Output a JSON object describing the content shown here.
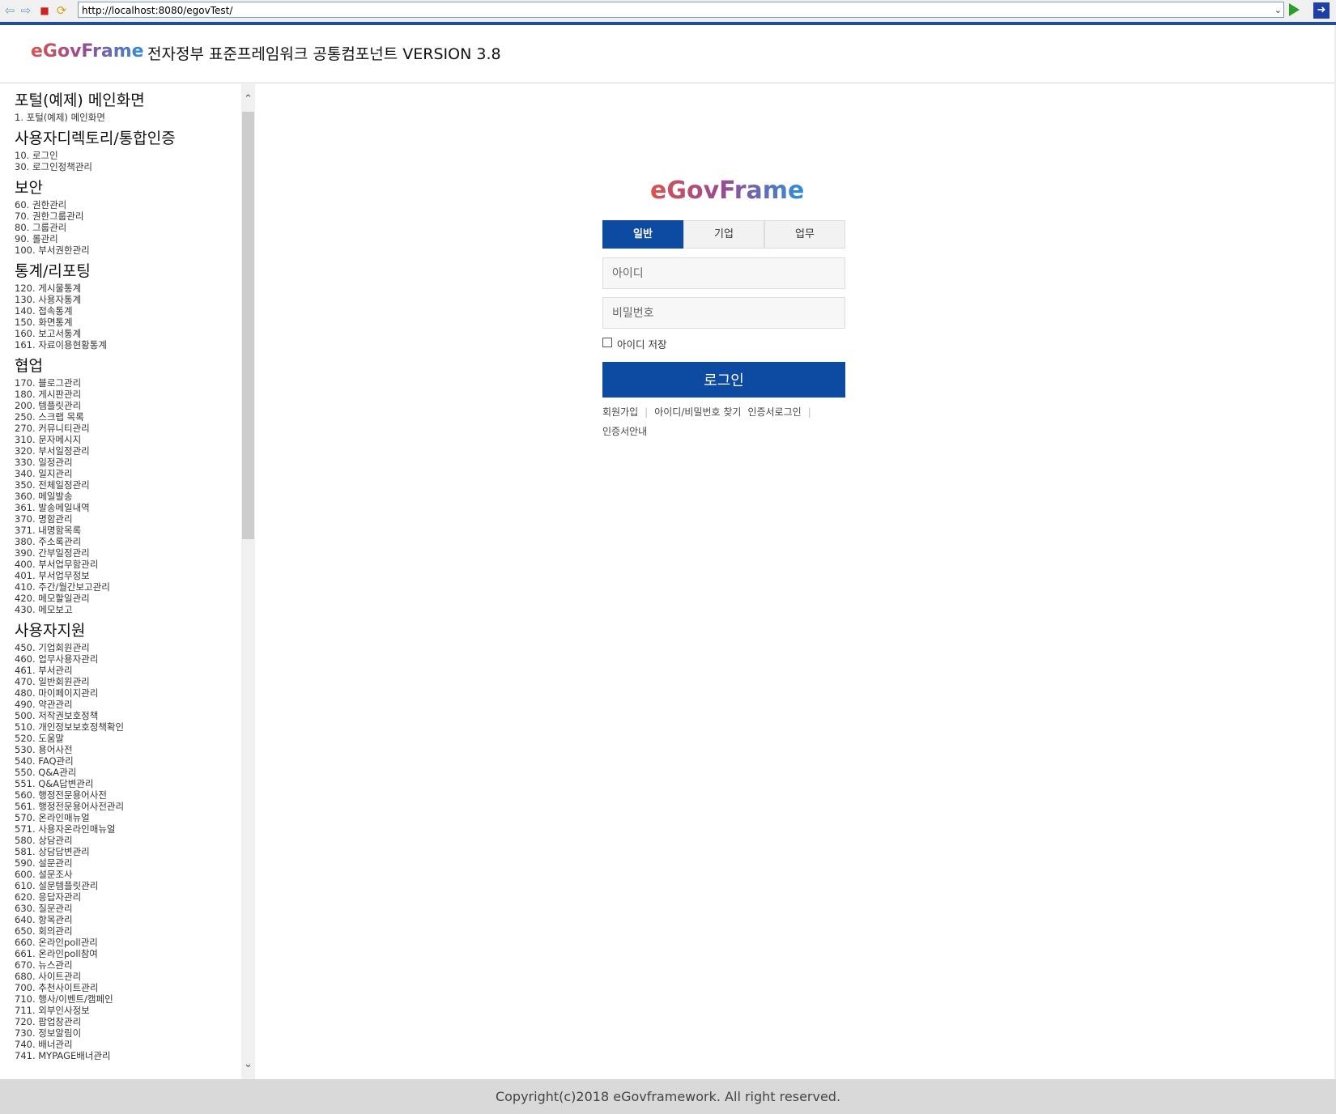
{
  "browser": {
    "url": "http://localhost:8080/egovTest/",
    "icons": [
      "back-icon",
      "forward-icon",
      "stop-icon",
      "refresh-icon",
      "dropdown-icon",
      "go-icon",
      "extension-icon"
    ]
  },
  "header": {
    "logo": "eGovFrame",
    "title": "전자정부 표준프레임워크 공통컴포넌트 VERSION 3.8"
  },
  "sidebar": {
    "groups": [
      {
        "title": "포털(예제) 메인화면",
        "items": [
          "1. 포털(예제) 메인화면"
        ]
      },
      {
        "title": "사용자디렉토리/통합인증",
        "items": [
          "10. 로그인",
          "30. 로그인정책관리"
        ]
      },
      {
        "title": "보안",
        "items": [
          "60. 권한관리",
          "70. 권한그룹관리",
          "80. 그룹관리",
          "90. 롤관리",
          "100. 부서권한관리"
        ]
      },
      {
        "title": "통계/리포팅",
        "items": [
          "120. 게시물통계",
          "130. 사용자통계",
          "140. 접속통계",
          "150. 화면통계",
          "160. 보고서통계",
          "161. 자료이용현황통계"
        ]
      },
      {
        "title": "협업",
        "items": [
          "170. 블로그관리",
          "180. 게시판관리",
          "200. 템플릿관리",
          "250. 스크랩 목록",
          "270. 커뮤니티관리",
          "310. 문자메시지",
          "320. 부서일정관리",
          "330. 일정관리",
          "340. 일지관리",
          "350. 전체일정관리",
          "360. 메일발송",
          "361. 발송메일내역",
          "370. 명함관리",
          "371. 내명함목록",
          "380. 주소록관리",
          "390. 간부일정관리",
          "400. 부서업무함관리",
          "401. 부서업무정보",
          "410. 주간/월간보고관리",
          "420. 메모할일관리",
          "430. 메모보고"
        ]
      },
      {
        "title": "사용자지원",
        "items": [
          "450. 기업회원관리",
          "460. 업무사용자관리",
          "461. 부서관리",
          "470. 일반회원관리",
          "480. 마이페이지관리",
          "490. 약관관리",
          "500. 저작권보호정책",
          "510. 개인정보보호정책확인",
          "520. 도움말",
          "530. 용어사전",
          "540. FAQ관리",
          "550. Q&A관리",
          "551. Q&A답변관리",
          "560. 행정전문용어사전",
          "561. 행정전문용어사전관리",
          "570. 온라인매뉴얼",
          "571. 사용자온라인매뉴얼",
          "580. 상담관리",
          "581. 상담답변관리",
          "590. 설문관리",
          "600. 설문조사",
          "610. 설문템플릿관리",
          "620. 응답자관리",
          "630. 질문관리",
          "640. 항목관리",
          "650. 회의관리",
          "660. 온라인poll관리",
          "661. 온라인poll참여",
          "670. 뉴스관리",
          "680. 사이트관리",
          "700. 추천사이트관리",
          "710. 행사/이벤트/캠페인",
          "711. 외부인사정보",
          "720. 팝업창관리",
          "730. 정보알림이",
          "740. 배너관리",
          "741. MYPAGE배너관리"
        ]
      }
    ]
  },
  "login": {
    "logo": "eGovFrame",
    "tabs": [
      {
        "label": "일반",
        "active": true
      },
      {
        "label": "기업",
        "active": false
      },
      {
        "label": "업무",
        "active": false
      }
    ],
    "id_placeholder": "아이디",
    "password_placeholder": "비밀번호",
    "save_id_label": "아이디 저장",
    "save_id_checked": false,
    "login_button": "로그인",
    "links": [
      "회원가입",
      "아이디/비밀번호 찾기",
      "인증서로그인",
      "인증서안내"
    ],
    "accent_color": "#0d4aa1"
  },
  "footer": {
    "copyright": "Copyright(c)2018 eGovframework. All right reserved."
  }
}
